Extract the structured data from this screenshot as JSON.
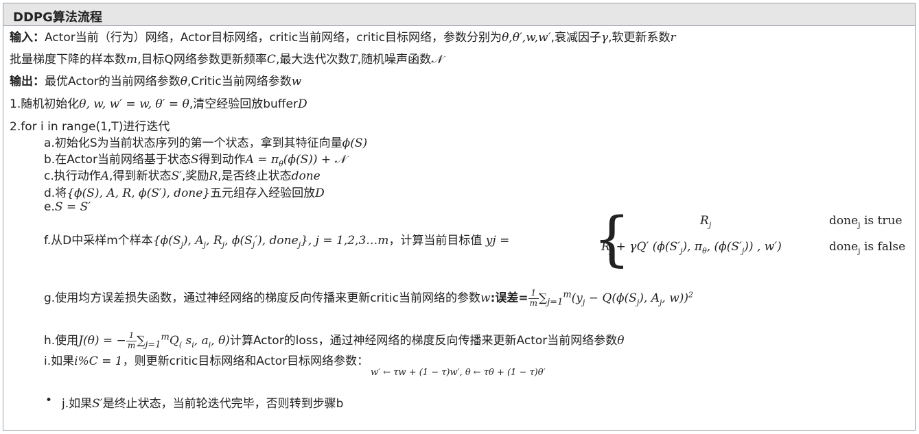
{
  "title": "DDPG算法流程",
  "input": {
    "label": "输入：",
    "text1": "Actor当前（行为）网络，Actor目标网络，critic当前网络，critic目标网络，参数分别为",
    "params": "θ,θ′,w,w′",
    "text2": ",衰减因子",
    "gamma": "γ",
    "text3": ",软更新系数",
    "r": "r",
    "line2_a": "批量梯度下降的样本数",
    "m": "m",
    "line2_b": ",目标Q网络参数更新频率",
    "C": "C",
    "line2_c": ",最大迭代次数",
    "T": "T",
    "line2_d": ",随机噪声函数",
    "N": "𝒩"
  },
  "output": {
    "label": "输出：",
    "text1": "最优Actor的当前网络参数",
    "theta": "θ",
    "text2": ",Critic当前网络参数",
    "w": "w"
  },
  "step1": {
    "text1": "1.随机初始化",
    "math": "θ, w, w′ = w, θ′ = θ",
    "text2": ",清空经验回放buffer",
    "D": "D"
  },
  "step2": {
    "text": "2.for i in range(1,T)进行迭代"
  },
  "step_a": {
    "text": "a.初始化S为当前状态序列的第一个状态，拿到其特征向量",
    "math": "ϕ(S)"
  },
  "step_b": {
    "text": "b.在Actor当前网络基于状态",
    "S": "S",
    "text2": "得到动作",
    "math": "A = π",
    "sub": "θ",
    "math2": "(ϕ(S)) + 𝒩"
  },
  "step_c": {
    "text": "c.执行动作",
    "A": "A",
    "text2": ",得到新状态",
    "S2": "S′",
    "text3": ",奖励",
    "R": "R",
    "text4": ",是否终止状态",
    "done": "done"
  },
  "step_d": {
    "text": "d.将",
    "math": "{ϕ(S), A, R, ϕ(S′), done}",
    "text2": "五元组存入经验回放",
    "D": "D"
  },
  "step_e": {
    "text": "e.",
    "math": "S = S′"
  },
  "step_f": {
    "text": "f.从D中采样m个样本",
    "math": "{ϕ(S",
    "math_rest": "), A",
    "math_rest2": ", R",
    "math_rest3": ", ϕ(S",
    "math_rest4": "′), done",
    "math_rest5": "}, j = 1,2,3…m",
    "sub_j": "j",
    "text2": "，计算当前目标值",
    "yj": "yj =",
    "case1_expr": "R",
    "case1_cond": "done",
    "case1_cond_rest": " is true",
    "case2_expr": "R",
    "case2_expr_rest": " + γQ′ (ϕ(S′",
    "case2_expr_rest2": "), π",
    "case2_theta": "θ",
    "case2_expr_rest3": ", (ϕ(S′",
    "case2_expr_rest4": ")) , w′)",
    "case2_cond": "done",
    "case2_cond_rest": " is false"
  },
  "step_g": {
    "text": "g.使用均方误差损失函数，通过神经网络的梯度反向传播来更新critic当前网络的参数",
    "w": "w",
    "text2": ":误差=",
    "frac_num": "1",
    "frac_den": "m",
    "sum": "∑",
    "sum_sub": "j=1",
    "sum_sup": "m",
    "expr": "(y",
    "expr_rest": " − Q(ϕ(S",
    "expr_rest2": "), A",
    "expr_rest3": ", w))",
    "power": "2"
  },
  "step_h": {
    "text": "h.使用",
    "math": "J(θ) = −",
    "frac_num": "1",
    "frac_den": "m",
    "sum": "∑",
    "sum_sub": "j=1",
    "sum_sup": "m",
    "expr": "Q",
    "expr_sub": "(",
    "expr_rest": " s",
    "expr_si": "i",
    "expr_rest2": ", a",
    "expr_ai": "i",
    "expr_rest3": ", θ)",
    "text2": "计算Actor的loss，通过神经网络的梯度反向传播来更新Actor当前网络参数",
    "theta": "θ"
  },
  "step_i": {
    "text": "i.如果",
    "math": "i%C = 1",
    "text2": "，则更新critic目标网络和Actor目标网络参数：",
    "update": "w′ ← τw + (1 − τ)w′,  θ ← τθ + (1 − τ)θ′"
  },
  "step_j": {
    "bullet": "•",
    "text": "j.如果",
    "S": "S′",
    "text2": "是终止状态，当前轮迭代完毕，否则转到步骤b"
  }
}
